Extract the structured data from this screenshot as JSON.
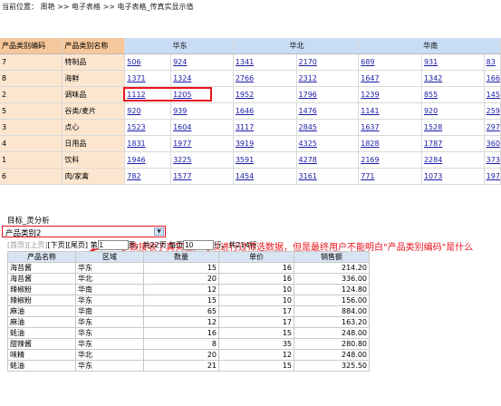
{
  "breadcrumb": "当前位置： 周艳 >> 电子表格 >> 电子表格_传真实显示值",
  "top_table": {
    "col_code": "产品类别编码",
    "col_name": "产品类别名称",
    "regions": [
      "华东",
      "华北",
      "华南"
    ],
    "rows": [
      {
        "code": "7",
        "name": "特制品",
        "values": [
          "506",
          "924",
          "1341",
          "2170",
          "689",
          "931",
          "83"
        ]
      },
      {
        "code": "8",
        "name": "海鲜",
        "values": [
          "1371",
          "1324",
          "2766",
          "2312",
          "1647",
          "1342",
          "166"
        ]
      },
      {
        "code": "2",
        "name": "调味品",
        "values": [
          "1112",
          "1205",
          "1952",
          "1796",
          "1239",
          "855",
          "145"
        ]
      },
      {
        "code": "5",
        "name": "谷类/麦片",
        "values": [
          "920",
          "939",
          "1646",
          "1476",
          "1141",
          "920",
          "259"
        ]
      },
      {
        "code": "3",
        "name": "点心",
        "values": [
          "1523",
          "1604",
          "3117",
          "2845",
          "1637",
          "1528",
          "297"
        ]
      },
      {
        "code": "4",
        "name": "日用品",
        "values": [
          "1831",
          "1977",
          "3919",
          "4325",
          "1828",
          "1787",
          "360"
        ]
      },
      {
        "code": "1",
        "name": "饮料",
        "values": [
          "1946",
          "3225",
          "3591",
          "4278",
          "2169",
          "2284",
          "373"
        ]
      },
      {
        "code": "6",
        "name": "肉/家禽",
        "values": [
          "782",
          "1577",
          "1454",
          "3161",
          "771",
          "1073",
          "197"
        ]
      }
    ]
  },
  "annotation": "参数接收了真实值，可以进行过筛选数据，但是最终用户不能明白\"产品类别编码\"是什么",
  "filter": {
    "title": "目标_灵分析",
    "selected": "产品类别2"
  },
  "pager": {
    "first": "[首页]",
    "prev": "[上页]",
    "next": "[下页]",
    "last": "[尾页]",
    "page_prefix": "第",
    "page_value": "1",
    "page_suffix": "页，共22页 每页",
    "rows_value": "10",
    "rows_suffix": "行，共214行"
  },
  "bottom_table": {
    "headers": [
      "产品名称",
      "区域",
      "数量",
      "单价",
      "销售额"
    ],
    "rows": [
      [
        "海苔酱",
        "华东",
        "15",
        "16",
        "214.20"
      ],
      [
        "海苔酱",
        "华北",
        "20",
        "16",
        "336.00"
      ],
      [
        "辣椒粉",
        "华南",
        "12",
        "10",
        "124.80"
      ],
      [
        "辣椒粉",
        "华东",
        "15",
        "10",
        "156.00"
      ],
      [
        "麻油",
        "华南",
        "65",
        "17",
        "884.00"
      ],
      [
        "麻油",
        "华东",
        "12",
        "17",
        "163.20"
      ],
      [
        "蚝油",
        "华东",
        "16",
        "15",
        "248.00"
      ],
      [
        "甜辣酱",
        "华东",
        "8",
        "35",
        "280.80"
      ],
      [
        "味精",
        "华北",
        "20",
        "12",
        "248.00"
      ],
      [
        "蚝油",
        "华东",
        "21",
        "15",
        "325.50"
      ]
    ]
  }
}
